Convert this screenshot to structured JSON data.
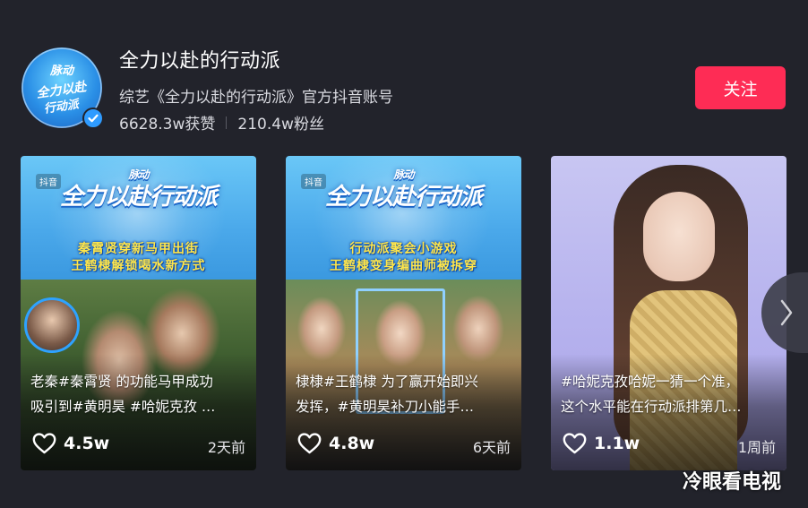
{
  "account": {
    "name": "全力以赴的行动派",
    "description": "综艺《全力以赴的行动派》官方抖音账号",
    "likes": "6628.3w获赞",
    "followers": "210.4w粉丝",
    "follow_label": "关注",
    "avatar_text_top": "脉动",
    "avatar_text_main": "全力以赴的行动派",
    "verified_icon": "check-badge-icon"
  },
  "videos": [
    {
      "platform_tag": "抖音",
      "brand_small": "脉动",
      "brand_main": "全力以赴行动派",
      "banner_lines": [
        "秦霄贤穿新马甲出街",
        "王鹤棣解锁喝水新方式"
      ],
      "caption_lines": [
        "老秦#秦霄贤 的功能马甲成功",
        "吸引到#黄明昊 #哈妮克孜 …"
      ],
      "likes": "4.5w",
      "date": "2天前"
    },
    {
      "platform_tag": "抖音",
      "brand_small": "脉动",
      "brand_main": "全力以赴行动派",
      "banner_lines": [
        "行动派聚会小游戏",
        "王鹤棣变身编曲师被拆穿"
      ],
      "caption_lines": [
        "棣棣#王鹤棣 为了赢开始即兴",
        "发挥，#黄明昊补刀小能手…"
      ],
      "likes": "4.8w",
      "date": "6天前"
    },
    {
      "platform_tag": "",
      "brand_small": "",
      "brand_main": "",
      "banner_lines": [],
      "caption_lines": [
        "#哈妮克孜哈妮一猜一个准，",
        "这个水平能在行动派排第几…"
      ],
      "likes": "1.1w",
      "date": "1周前"
    }
  ],
  "watermark": "冷眼看电视",
  "colors": {
    "background": "#22232b",
    "follow_button": "#fe2c55",
    "verified": "#2f9bff"
  }
}
